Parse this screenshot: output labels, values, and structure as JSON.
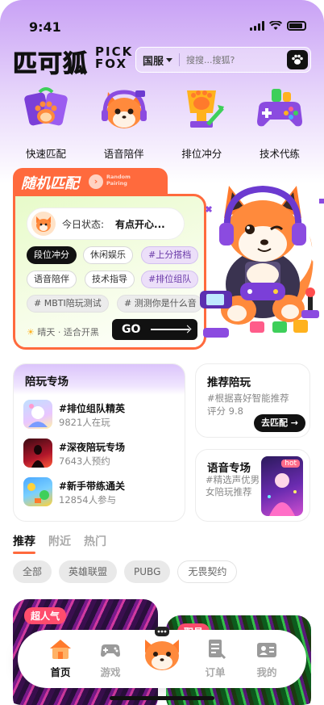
{
  "status": {
    "time": "9:41"
  },
  "header": {
    "logo_cn": "匹可狐",
    "logo_en_1": "PICK",
    "logo_en_2": "FOX",
    "region": "国服",
    "search_placeholder": "搜搜...搜狐?"
  },
  "quick_nav": [
    {
      "label": "快速匹配",
      "icon": "controller-paw-icon"
    },
    {
      "label": "语音陪伴",
      "icon": "fox-headset-icon"
    },
    {
      "label": "排位冲分",
      "icon": "trophy-paw-icon"
    },
    {
      "label": "技术代练",
      "icon": "gamepad-icon"
    }
  ],
  "random_match": {
    "title": "随机匹配",
    "title_en_1": "Random",
    "title_en_2": "Pairing",
    "mood_label": "今日状态:",
    "mood_value": "有点开心...",
    "tags": [
      "段位冲分",
      "休闲娱乐",
      "#上分搭档",
      "语音陪伴",
      "技术指导",
      "#排位组队",
      "# MBTI陪玩测试",
      "# 测测你是什么音"
    ],
    "weather": "晴天 · 适合开黑",
    "go_label": "GO"
  },
  "play_zone": {
    "title": "陪玩专场",
    "items": [
      {
        "name": "#排位组队精英",
        "sub": "9821人在玩"
      },
      {
        "name": "#深夜陪玩专场",
        "sub": "7643人预约"
      },
      {
        "name": "#新手带练通关",
        "sub": "12854人参与"
      }
    ]
  },
  "recommend": {
    "title": "推荐陪玩",
    "sub1": "#根据喜好智能推荐",
    "sub2": "评分 9.8",
    "button": "去匹配 →"
  },
  "voice": {
    "title": "语音专场",
    "sub": "#精选声优男女陪玩推荐",
    "hot": "hot"
  },
  "feed_tabs": [
    "推荐",
    "附近",
    "热门"
  ],
  "filters": [
    "全部",
    "英雄联盟",
    "PUBG",
    "无畏契约"
  ],
  "feed": {
    "badge1": "超人气",
    "badge2": "职员"
  },
  "bottom_nav": {
    "items": [
      "首页",
      "游戏",
      "订单",
      "我的"
    ],
    "active": "首页"
  },
  "colors": {
    "accent": "#ff6a3d",
    "purple": "#b98cf5",
    "dark": "#111111"
  }
}
